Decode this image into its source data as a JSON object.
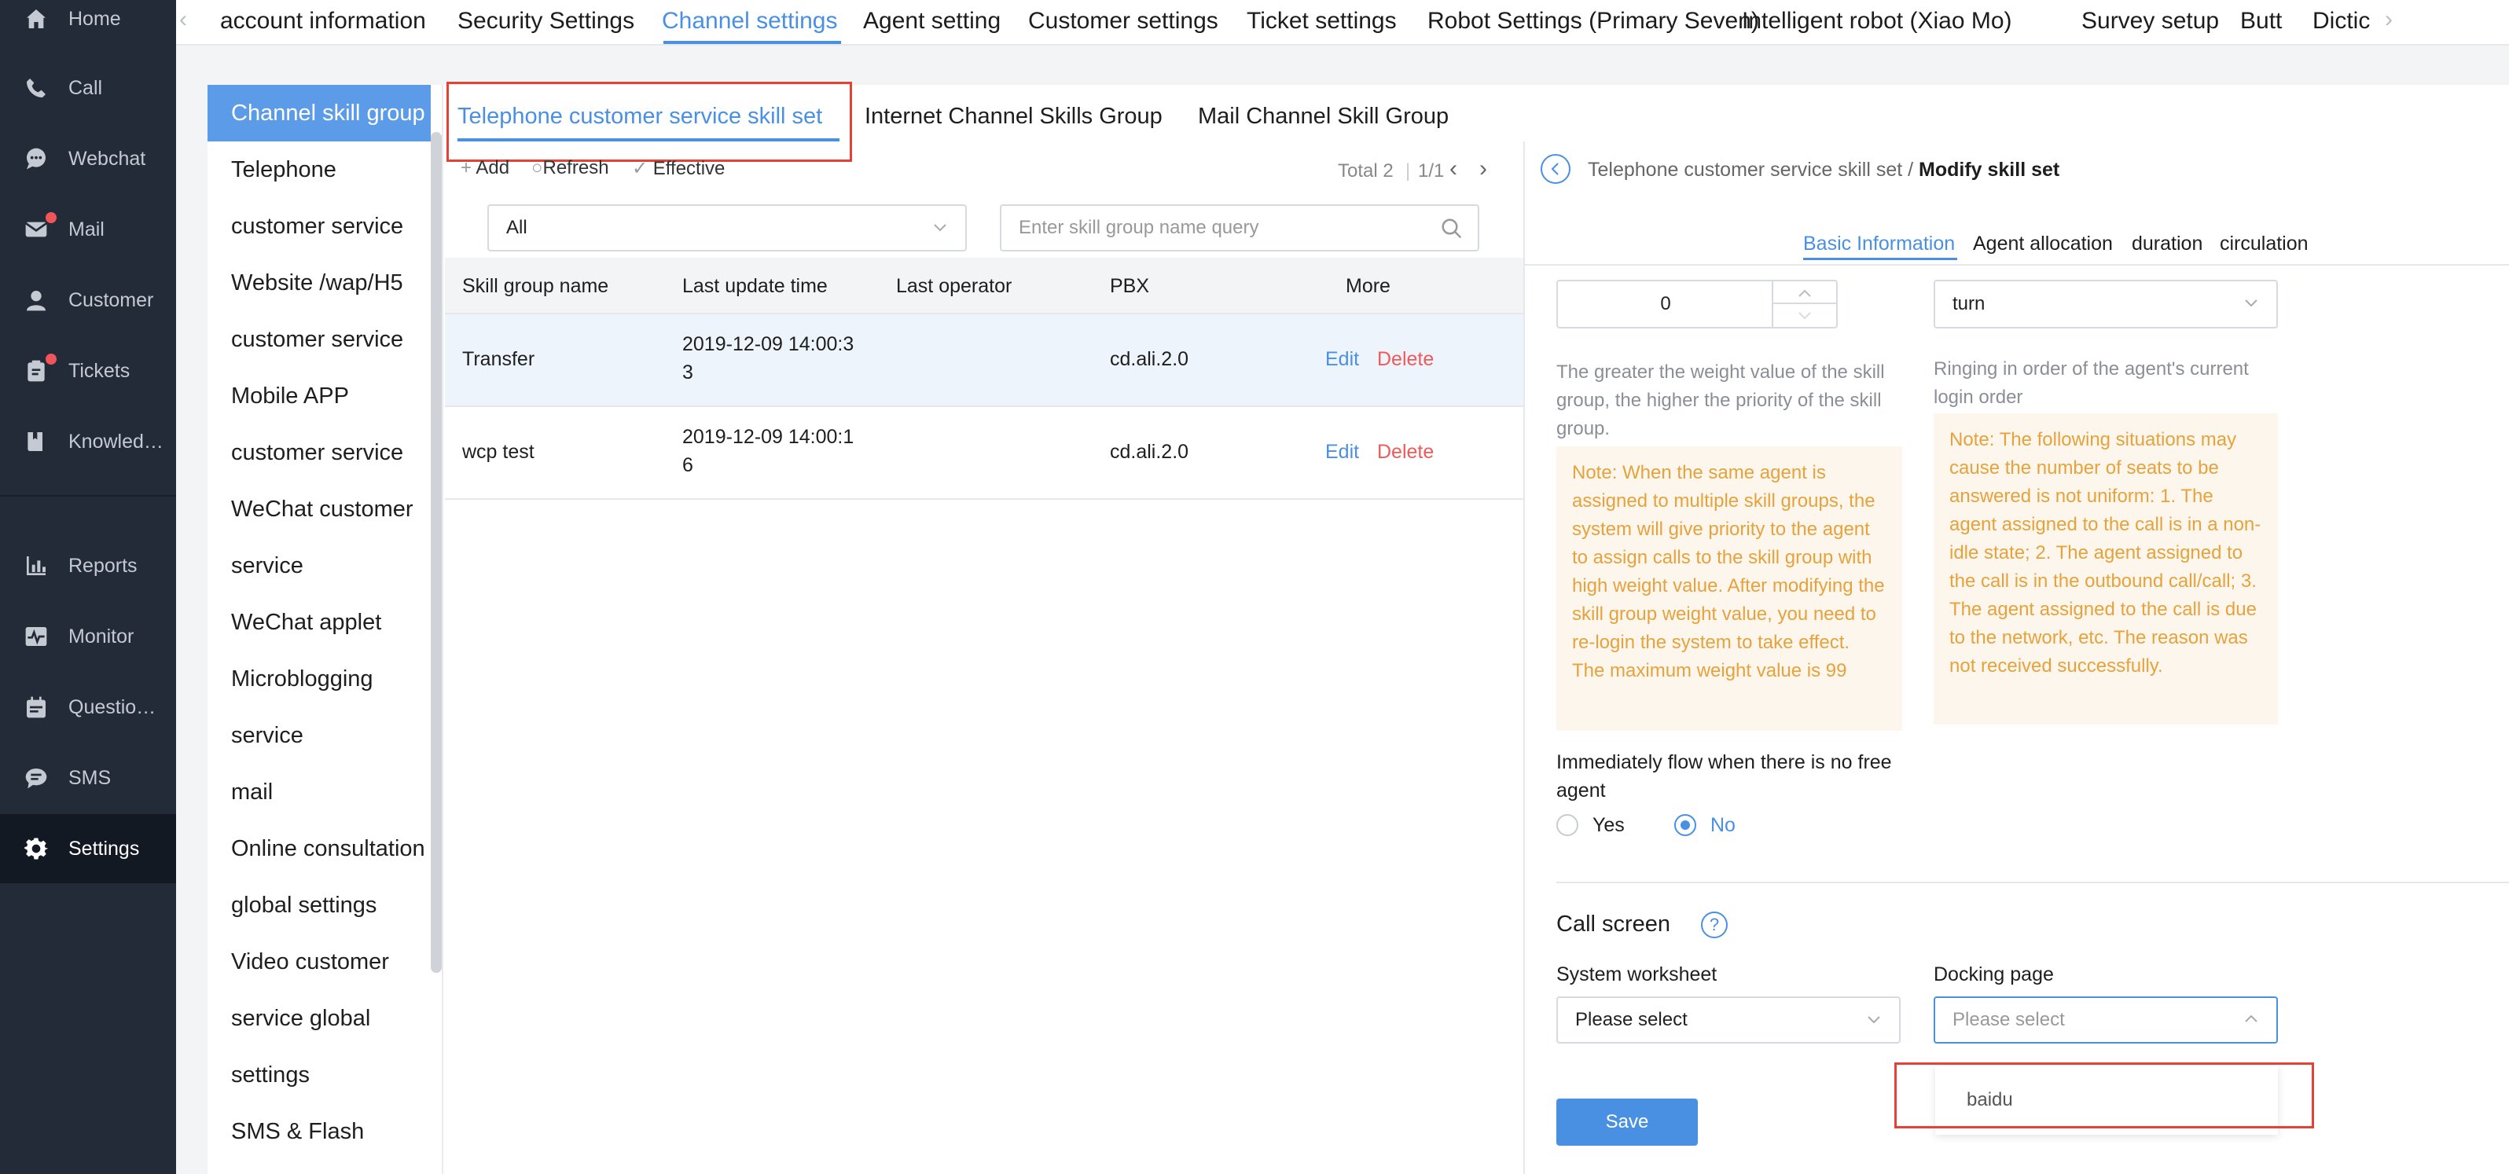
{
  "nav": {
    "items": [
      {
        "label": "Home",
        "icon": "home-icon"
      },
      {
        "label": "Call",
        "icon": "phone-icon"
      },
      {
        "label": "Webchat",
        "icon": "chat-bubble-icon"
      },
      {
        "label": "Mail",
        "icon": "mail-icon"
      },
      {
        "label": "Customer",
        "icon": "user-icon"
      },
      {
        "label": "Tickets",
        "icon": "clipboard-icon"
      },
      {
        "label": "Knowledge base",
        "icon": "book-icon"
      },
      {
        "label": "Reports",
        "icon": "bar-chart-icon"
      },
      {
        "label": "Monitor",
        "icon": "monitor-icon"
      },
      {
        "label": "Questionnaire",
        "icon": "calendar-icon"
      },
      {
        "label": "SMS",
        "icon": "sms-icon"
      },
      {
        "label": "Settings",
        "icon": "gear-icon"
      }
    ],
    "active": "Settings"
  },
  "top_tabs": [
    "account information",
    "Security Settings",
    "Channel settings",
    "Agent setting",
    "Customer settings",
    "Ticket settings",
    "Robot Settings (Primary Seven)",
    "Intelligent robot (Xiao Mo)",
    "Survey setup",
    "Butt",
    "Dictic"
  ],
  "top_tabs_active": "Channel settings",
  "sublist": [
    "Channel skill group",
    "Telephone",
    "customer service",
    "Website /wap/H5",
    "customer service",
    "Mobile APP",
    "customer service",
    "WeChat customer",
    "service",
    "WeChat applet",
    "Microblogging",
    "service",
    "mail",
    "Online consultation",
    "global settings",
    "Video customer",
    "service global",
    "settings",
    "SMS & Flash"
  ],
  "group_tabs": [
    "Telephone customer service skill set",
    "Internet Channel Skills Group",
    "Mail Channel Skill Group"
  ],
  "toolbar": {
    "add": "Add",
    "refresh": "Refresh",
    "effective": "Effective",
    "total": "Total 2",
    "page": "1/1"
  },
  "filter": {
    "select_value": "All",
    "search_placeholder": "Enter skill group name query"
  },
  "table": {
    "headers": [
      "Skill group name",
      "Last update time",
      "Last operator",
      "PBX",
      "More"
    ],
    "rows": [
      {
        "name": "Transfer",
        "time_line1": "2019-12-09 14:00:3",
        "time_line2": "3",
        "operator": "",
        "pbx": "cd.ali.2.0",
        "edit": "Edit",
        "delete": "Delete"
      },
      {
        "name": "wcp test",
        "time_line1": "2019-12-09 14:00:1",
        "time_line2": "6",
        "operator": "",
        "pbx": "cd.ali.2.0",
        "edit": "Edit",
        "delete": "Delete"
      }
    ]
  },
  "detail": {
    "crumb_parent": "Telephone customer service skill set",
    "crumb_sep": " / ",
    "crumb_current": "Modify skill set",
    "tabs": [
      "Basic Information",
      "Agent allocation",
      "duration",
      "circulation"
    ],
    "weight_value": "0",
    "strategy_value": "turn",
    "weight_hint": "The greater the weight value of the skill group, the higher the priority of the skill group.",
    "weight_note": "Note: When the same agent is assigned to multiple skill groups, the system will give priority to the agent to assign calls to the skill group with high weight value. After modifying the skill group weight value, you need to re-login the system to take effect. The maximum weight value is 99",
    "strategy_hint": "Ringing in order of the agent's current login order",
    "strategy_note": "Note: The following situations may cause the number of seats to be answered is not uniform: 1. The agent assigned to the call is in a non-idle state; 2. The agent assigned to the call is in the outbound call/call; 3. The agent assigned to the call is due to the network, etc. The reason was not received successfully.",
    "flow_label": "Immediately flow when there is no free agent",
    "yes": "Yes",
    "no": "No",
    "call_screen": "Call screen",
    "system_worksheet": "System worksheet",
    "system_worksheet_value": "Please select",
    "docking_page": "Docking page",
    "docking_page_placeholder": "Please select",
    "dropdown_option": "baidu",
    "save": "Save"
  },
  "colors": {
    "accent": "#4a90e2",
    "danger": "#ee5a5a",
    "nav_bg": "#232b38",
    "note_bg": "#fdf6ec",
    "note_text": "#e6a23c",
    "highlight_box": "#e34234"
  }
}
